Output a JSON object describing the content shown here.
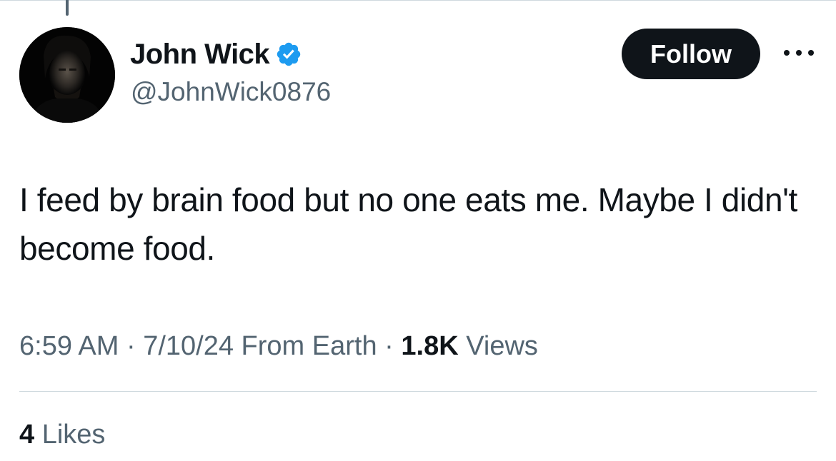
{
  "author": {
    "display_name": "John Wick",
    "handle": "@JohnWick0876",
    "verified": true,
    "verified_color": "#1d9bf0",
    "avatar_icon": "profile-photo"
  },
  "actions": {
    "follow_label": "Follow",
    "more_icon": "more-horizontal-icon"
  },
  "tweet": {
    "text": "I feed by brain food but no one eats me. Maybe I didn't become food."
  },
  "meta": {
    "time": "6:59 AM",
    "sep1": " · ",
    "date": "7/10/24",
    "source": " From Earth",
    "sep2": " · ",
    "views_count": "1.8K",
    "views_label": " Views"
  },
  "engagement": {
    "likes_count": "4",
    "likes_label": " Likes"
  }
}
